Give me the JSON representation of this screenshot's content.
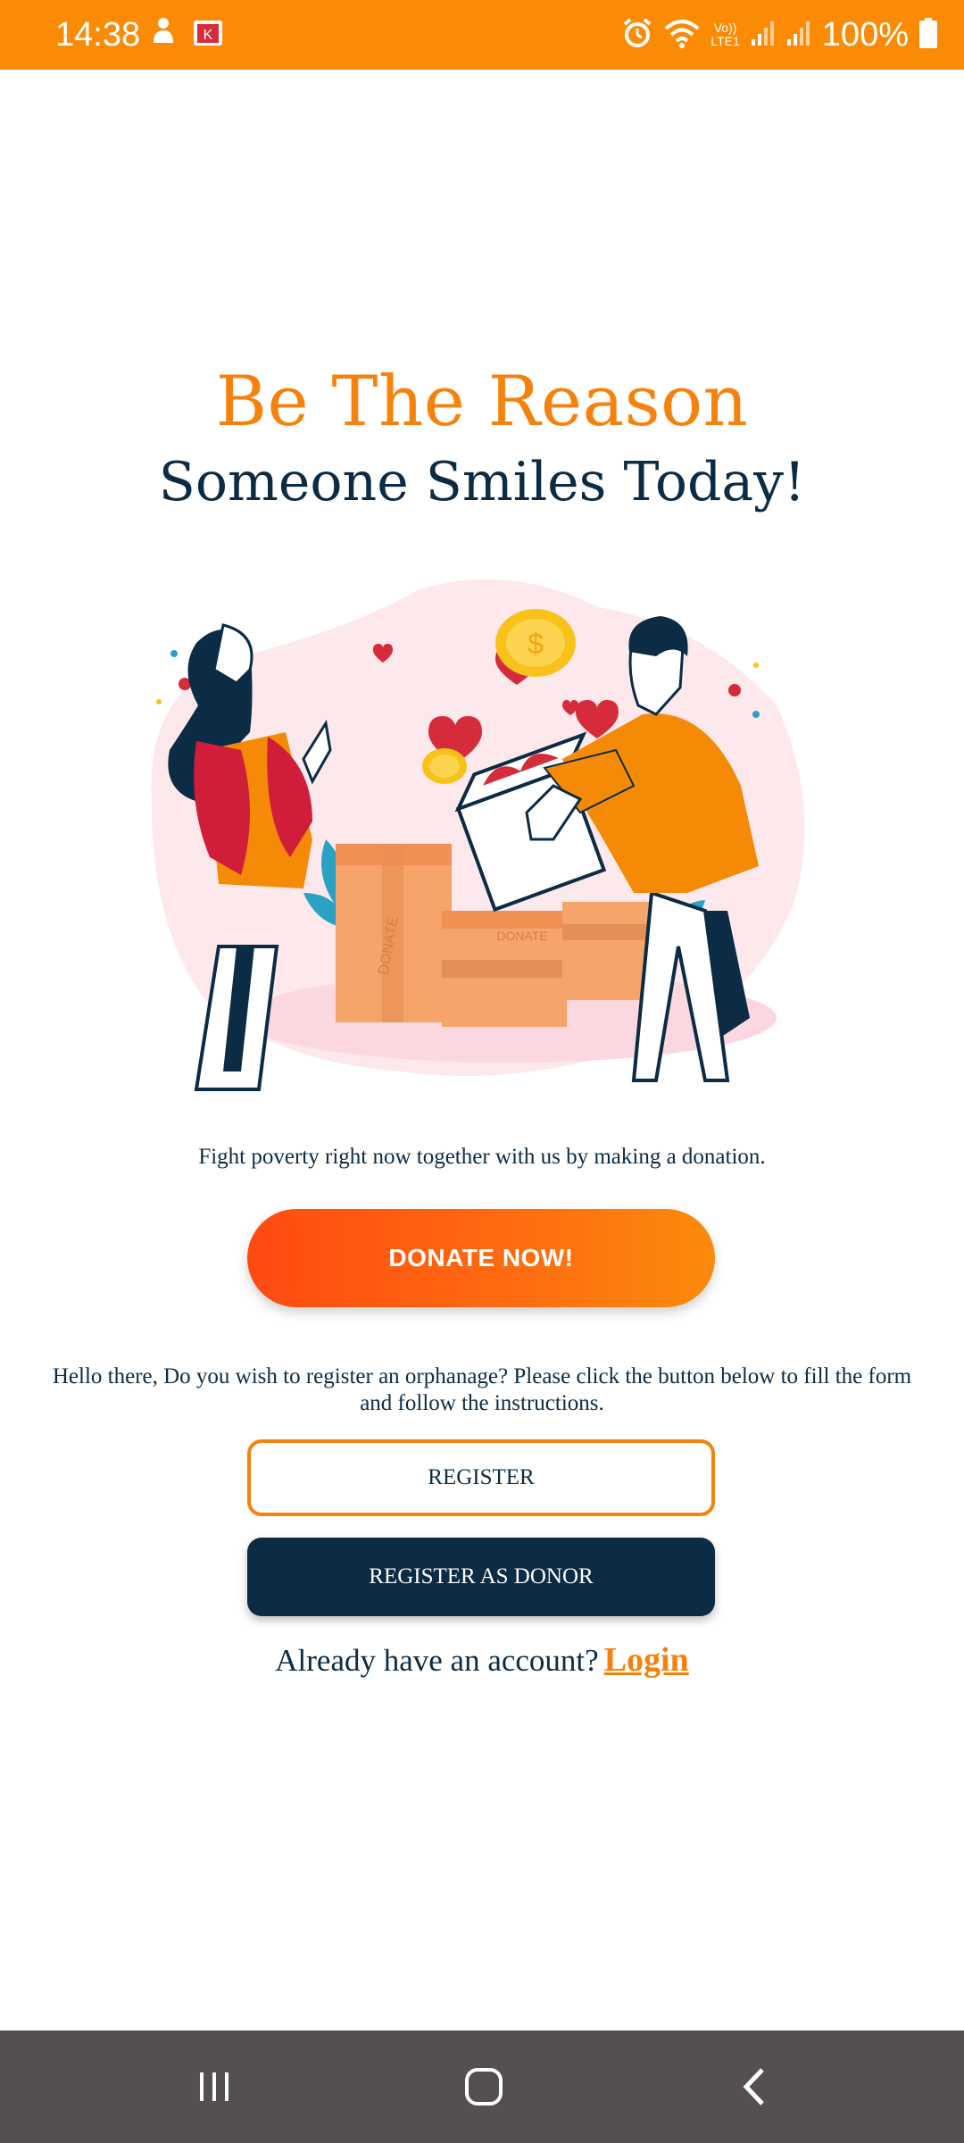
{
  "status_bar": {
    "time": "14:38",
    "battery_text": "100%",
    "icons": [
      "baby-icon",
      "shop-icon",
      "alarm-icon",
      "wifi-icon",
      "volte-icon",
      "signal-icon",
      "signal-icon",
      "battery-icon"
    ],
    "network_label_top": "Vo))",
    "network_label_bottom": "LTE1"
  },
  "hero": {
    "headline_primary": "Be The Reason",
    "headline_secondary": "Someone Smiles Today!"
  },
  "donate": {
    "tagline": "Fight poverty right now together with us by making a donation.",
    "button_label": "DONATE NOW!"
  },
  "register": {
    "info_text": "Hello there, Do you wish to register an orphanage? Please click the button below to fill the form and follow the instructions.",
    "register_label": "REGISTER",
    "register_donor_label": "REGISTER AS DONOR"
  },
  "login": {
    "prompt": "Already have an account?",
    "link_label": "Login"
  },
  "illustration": {
    "box_label": "DONATE"
  },
  "colors": {
    "accent": "#F5820C",
    "status_bar": "#FB8B05",
    "navy": "#0C2B44",
    "nav_bar": "#544F50"
  },
  "nav": {
    "icons": [
      "recent-apps-icon",
      "home-icon",
      "back-icon"
    ]
  }
}
